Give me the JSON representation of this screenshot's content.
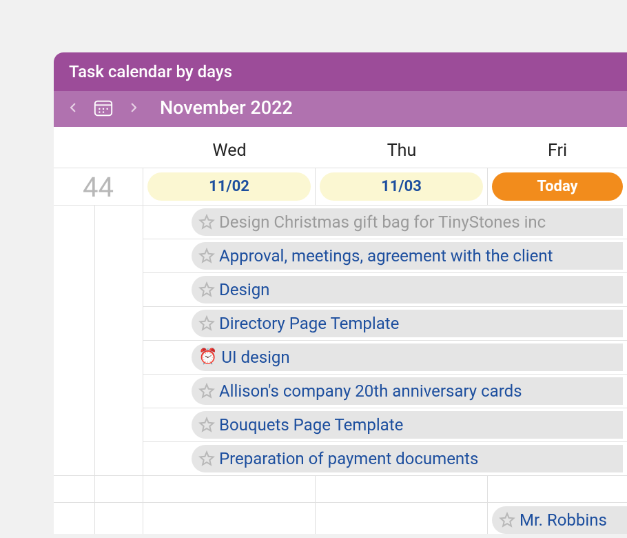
{
  "header": {
    "title": "Task calendar by days",
    "month_label": "November 2022"
  },
  "columns": {
    "wed": "Wed",
    "thu": "Thu",
    "fri": "Fri"
  },
  "week_number": "44",
  "dates": {
    "wed": "11/02",
    "thu": "11/03",
    "fri": "Today"
  },
  "tasks": [
    {
      "icon": "star",
      "label": "Design Christmas gift bag for TinyStones inc",
      "muted": true
    },
    {
      "icon": "star",
      "label": "Approval, meetings, agreement with the client",
      "muted": false
    },
    {
      "icon": "star",
      "label": "Design",
      "muted": false
    },
    {
      "icon": "star",
      "label": "Directory Page Template",
      "muted": false
    },
    {
      "icon": "clock",
      "label": "UI design",
      "muted": false
    },
    {
      "icon": "star",
      "label": "Allison's company 20th anniversary cards",
      "muted": false
    },
    {
      "icon": "star",
      "label": "Bouquets Page Template",
      "muted": false
    },
    {
      "icon": "star",
      "label": "Preparation of payment documents",
      "muted": false
    }
  ],
  "row2_task": {
    "label": "Mr. Robbins"
  },
  "icons": {
    "clock_emoji": "⏰"
  }
}
